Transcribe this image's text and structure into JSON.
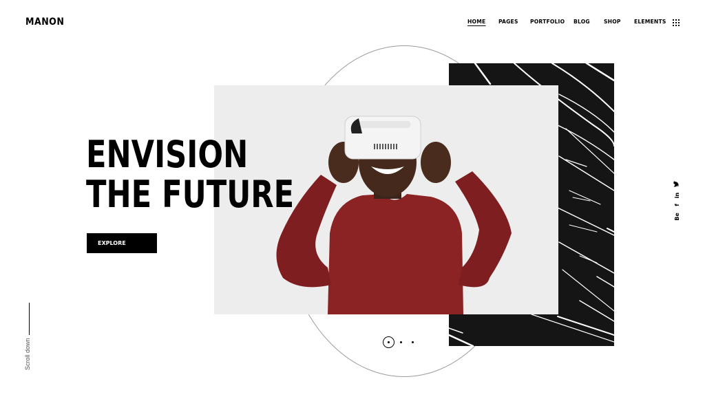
{
  "brand": {
    "logo_text": "MANON"
  },
  "nav": {
    "items": [
      {
        "label": "HOME",
        "active": true
      },
      {
        "label": "PAGES",
        "active": false
      },
      {
        "label": "PORTFOLIO",
        "active": false
      },
      {
        "label": "BLOG",
        "active": false
      },
      {
        "label": "SHOP",
        "active": false
      },
      {
        "label": "ELEMENTS",
        "active": false
      }
    ],
    "menu_icon": "grid-dots-icon"
  },
  "hero": {
    "title_line_1": "ENVISION",
    "title_line_2": "THE FUTURE",
    "cta_label": "EXPLORE",
    "image_subject": "man wearing white VR headset, red sweater",
    "panel_icon": "dark-abstract-lines"
  },
  "scroll": {
    "label": "Scroll down"
  },
  "social": [
    {
      "name": "twitter-icon",
      "glyph": "🐦"
    },
    {
      "name": "linkedin-icon",
      "glyph": "in"
    },
    {
      "name": "facebook-icon",
      "glyph": "f"
    },
    {
      "name": "behance-icon",
      "glyph": "Be"
    }
  ],
  "slider": {
    "count": 3,
    "active_index": 0
  },
  "colors": {
    "accent": "#000000",
    "background": "#ffffff",
    "sweater": "#8b2223",
    "panel": "#151515"
  }
}
